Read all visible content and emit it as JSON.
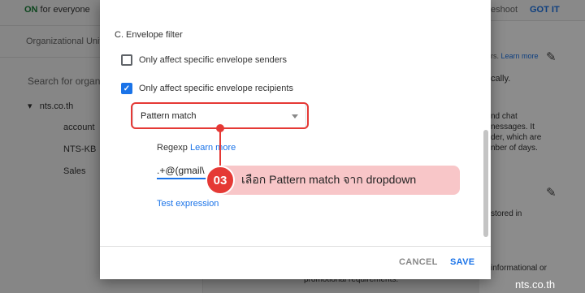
{
  "background": {
    "status_on": "ON",
    "status_rest": " for everyone",
    "org_units_label": "Organizational Units",
    "search_placeholder": "Search for organ",
    "tree_root": "nts.co.th",
    "tree_children": [
      "account",
      "NTS-KB",
      "Sales"
    ],
    "top_right_text": "eshoot",
    "got_it": "GOT IT",
    "right_texts": {
      "t1_gray": "rs.",
      "t1_link": "Learn more",
      "t2": "cally.",
      "t3": "nd chat",
      "t4": "nessages. It",
      "t5": "der, which are",
      "t6": "nber of days.",
      "t7": "stored in",
      "t8": "informational or",
      "t9": "promotional requirements."
    }
  },
  "dialog": {
    "section_title": "C. Envelope filter",
    "options": [
      {
        "label": "Only affect specific envelope senders",
        "checked": false
      },
      {
        "label": "Only affect specific envelope recipients",
        "checked": true
      }
    ],
    "select_value": "Pattern match",
    "regexp_label": "Regexp",
    "regexp_learn_more": "Learn more",
    "regexp_value": ".+@(gmail\\",
    "test_expression": "Test expression",
    "cancel_label": "CANCEL",
    "save_label": "SAVE"
  },
  "annotation": {
    "step_number": "03",
    "callout_text": "เลือก Pattern match จาก dropdown",
    "highlight_color": "#e53935",
    "callout_bg": "#f8c6c8"
  },
  "watermark": "nts.co.th",
  "colors": {
    "accent": "#1a73e8",
    "status_on": "#188038"
  }
}
